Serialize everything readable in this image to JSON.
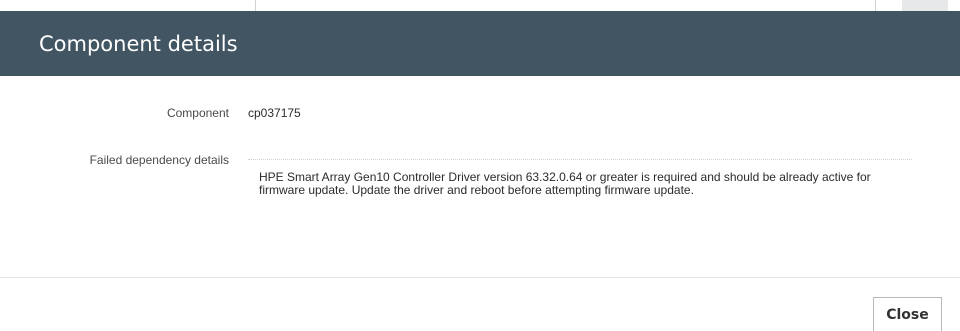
{
  "dialog": {
    "title": "Component details",
    "component_label": "Component",
    "component_value": "cp037175",
    "failed_dependency_label": "Failed dependency details",
    "failed_dependency_text": "HPE Smart Array Gen10 Controller Driver version 63.32.0.64 or greater is required and should be already active for firmware update. Update the driver and reboot before attempting firmware update.",
    "close_label": "Close"
  },
  "colors": {
    "header_bg": "#425563",
    "header_text": "#ffffff",
    "label_text": "#4a4a4a",
    "value_text": "#2b2b2b"
  }
}
